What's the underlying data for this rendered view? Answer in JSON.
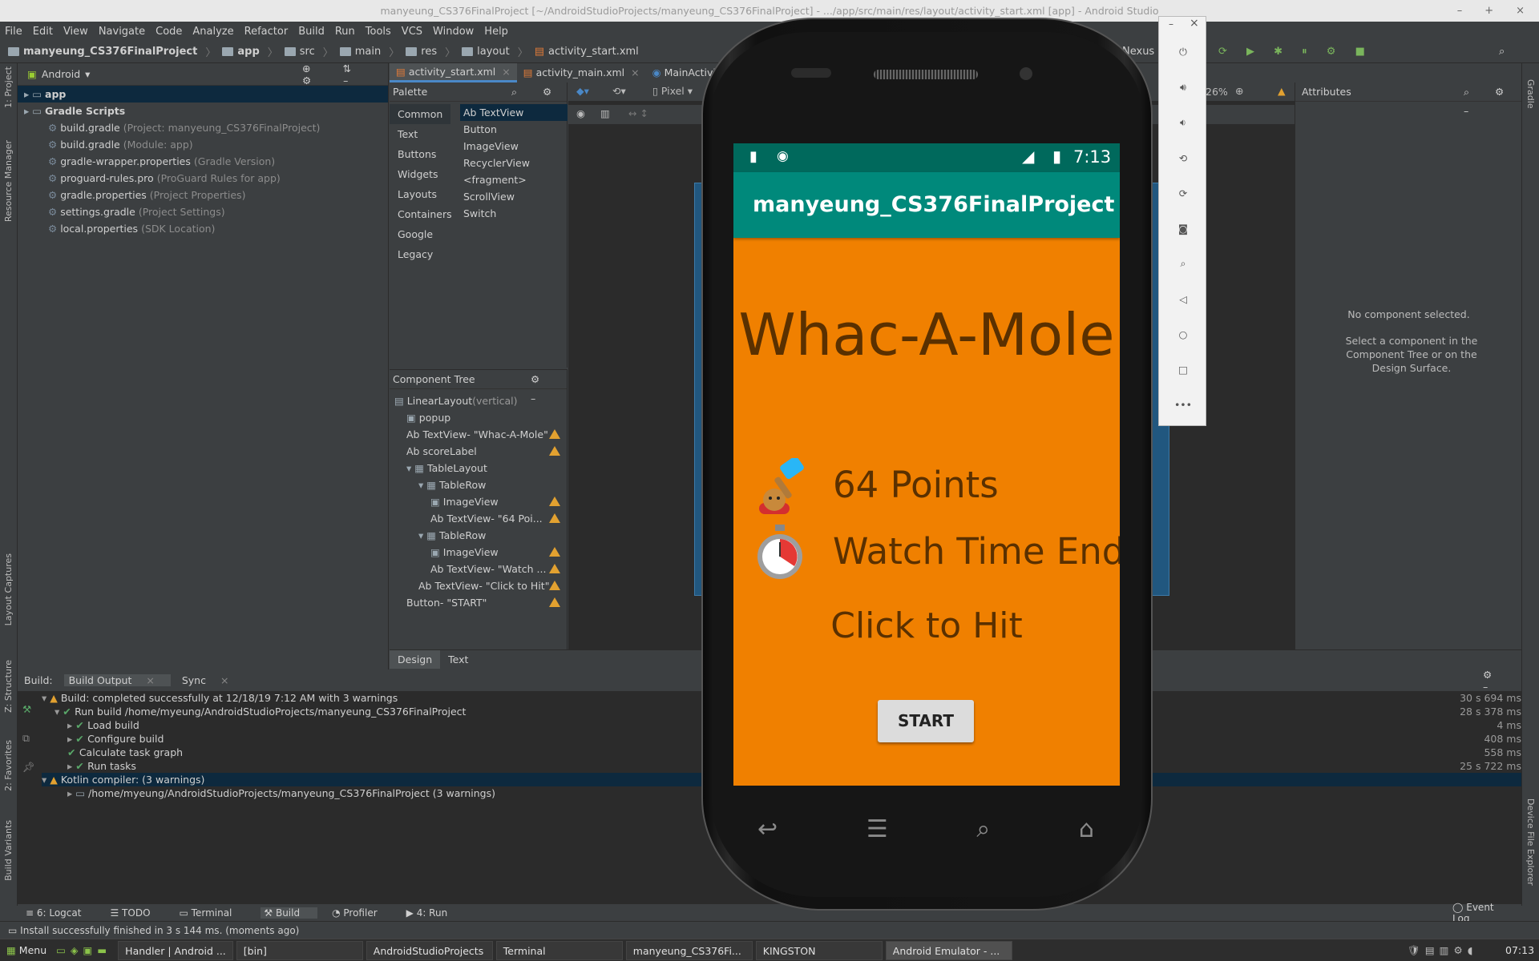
{
  "window": {
    "title": "manyeung_CS376FinalProject [~/AndroidStudioProjects/manyeung_CS376FinalProject] - .../app/src/main/res/layout/activity_start.xml [app] - Android Studio",
    "controls": [
      "–",
      "+",
      "×"
    ]
  },
  "menu": [
    "File",
    "Edit",
    "View",
    "Navigate",
    "Code",
    "Analyze",
    "Refactor",
    "Build",
    "Run",
    "Tools",
    "VCS",
    "Window",
    "Help"
  ],
  "breadcrumb": [
    "manyeung_CS376FinalProject",
    "app",
    "src",
    "main",
    "res",
    "layout",
    "activity_start.xml"
  ],
  "toolbar": {
    "device": "Nexus 5"
  },
  "left_strip": {
    "project": "1: Project",
    "resource": "Resource Manager",
    "captures": "Layout Captures",
    "structure": "Z: Structure",
    "favorites": "2: Favorites",
    "variants": "Build Variants"
  },
  "right_strip": {
    "gradle": "Gradle",
    "device_explorer": "Device File Explorer"
  },
  "project": {
    "view": "Android",
    "items": [
      {
        "label": "app",
        "dim": "",
        "indent": 0,
        "sel": true
      },
      {
        "label": "Gradle Scripts",
        "dim": "",
        "indent": 0
      },
      {
        "label": "build.gradle",
        "dim": "(Project: manyeung_CS376FinalProject)",
        "indent": 1
      },
      {
        "label": "build.gradle",
        "dim": "(Module: app)",
        "indent": 1
      },
      {
        "label": "gradle-wrapper.properties",
        "dim": "(Gradle Version)",
        "indent": 1
      },
      {
        "label": "proguard-rules.pro",
        "dim": "(ProGuard Rules for app)",
        "indent": 1
      },
      {
        "label": "gradle.properties",
        "dim": "(Project Properties)",
        "indent": 1
      },
      {
        "label": "settings.gradle",
        "dim": "(Project Settings)",
        "indent": 1
      },
      {
        "label": "local.properties",
        "dim": "(SDK Location)",
        "indent": 1
      }
    ]
  },
  "editor_tabs": [
    "activity_start.xml",
    "activity_main.xml",
    "MainActivity.kt"
  ],
  "palette": {
    "title": "Palette",
    "categories": [
      "Common",
      "Text",
      "Buttons",
      "Widgets",
      "Layouts",
      "Containers",
      "Google",
      "Legacy"
    ],
    "items": [
      "Ab TextView",
      "Button",
      "ImageView",
      "RecyclerView",
      "<fragment>",
      "ScrollView",
      "Switch"
    ]
  },
  "design_toolbar": {
    "device": "Pixel",
    "zoom": "26%"
  },
  "attributes": {
    "title": "Attributes",
    "empty": "No component selected.",
    "hint": "Select a component in the Component Tree or on the Design Surface."
  },
  "component_tree": {
    "title": "Component Tree",
    "rows": [
      {
        "label": "LinearLayout",
        "extra": "(vertical)",
        "indent": 0,
        "warn": false
      },
      {
        "label": "popup",
        "extra": "",
        "indent": 1,
        "warn": false
      },
      {
        "label": "Ab TextView- \"Whac-A-Mole\"",
        "extra": "",
        "indent": 1,
        "warn": true
      },
      {
        "label": "Ab scoreLabel",
        "extra": "",
        "indent": 1,
        "warn": true
      },
      {
        "label": "TableLayout",
        "extra": "",
        "indent": 1,
        "warn": false
      },
      {
        "label": "TableRow",
        "extra": "",
        "indent": 2,
        "warn": false
      },
      {
        "label": "ImageView",
        "extra": "",
        "indent": 3,
        "warn": true
      },
      {
        "label": "Ab TextView- \"64 Poi...",
        "extra": "",
        "indent": 3,
        "warn": true
      },
      {
        "label": "TableRow",
        "extra": "",
        "indent": 2,
        "warn": false
      },
      {
        "label": "ImageView",
        "extra": "",
        "indent": 3,
        "warn": true
      },
      {
        "label": "Ab TextView- \"Watch ...",
        "extra": "",
        "indent": 3,
        "warn": true
      },
      {
        "label": "Ab TextView- \"Click to Hit\"",
        "extra": "",
        "indent": 2,
        "warn": true
      },
      {
        "label": "Button- \"START\"",
        "extra": "",
        "indent": 1,
        "warn": true
      }
    ]
  },
  "design_tabs": [
    "Design",
    "Text"
  ],
  "build": {
    "tabs": [
      "Build:",
      "Build Output",
      "Sync"
    ],
    "rows": [
      {
        "text": "Build: completed successfully at 12/18/19 7:12 AM with 3 warnings",
        "time": "30 s 694 ms",
        "indent": 0,
        "hl": false
      },
      {
        "text": "Run build /home/myeung/AndroidStudioProjects/manyeung_CS376FinalProject",
        "time": "28 s 378 ms",
        "indent": 1,
        "hl": false
      },
      {
        "text": "Load build",
        "time": "4 ms",
        "indent": 2,
        "hl": false
      },
      {
        "text": "Configure build",
        "time": "408 ms",
        "indent": 2,
        "hl": false
      },
      {
        "text": "Calculate task graph",
        "time": "558 ms",
        "indent": 2,
        "hl": false
      },
      {
        "text": "Run tasks",
        "time": "25 s 722 ms",
        "indent": 2,
        "hl": false
      },
      {
        "text": "Kotlin compiler: (3 warnings)",
        "time": "",
        "indent": 0,
        "hl": true
      },
      {
        "text": "/home/myeung/AndroidStudioProjects/manyeung_CS376FinalProject (3 warnings)",
        "time": "",
        "indent": 2,
        "hl": false
      }
    ]
  },
  "bottom_tools": [
    "6: Logcat",
    "TODO",
    "Terminal",
    "Build",
    "Profiler",
    "4: Run"
  ],
  "event_log": "Event Log",
  "status": "Install successfully finished in 3 s 144 ms. (moments ago)",
  "taskbar": {
    "menu": "Menu",
    "tasks": [
      "Handler | Android ...",
      "[bin]",
      "AndroidStudioProjects",
      "Terminal",
      "manyeung_CS376Fi...",
      "KINGSTON",
      "Android Emulator - ..."
    ],
    "clock": "07:13"
  },
  "phone": {
    "time": "7:13",
    "app_title": "manyeung_CS376FinalProject",
    "game_title": "Whac-A-Mole",
    "points": "64 Points",
    "watch": "Watch Time End",
    "hit": "Click to Hit",
    "start": "START"
  }
}
